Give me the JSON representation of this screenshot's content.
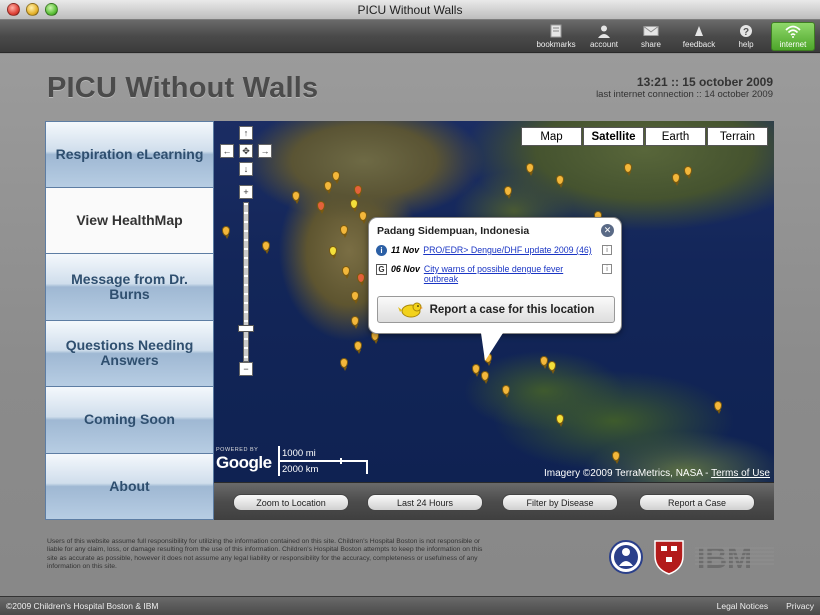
{
  "window": {
    "title": "PICU Without Walls"
  },
  "toolbar": {
    "items": [
      {
        "label": "bookmarks",
        "icon": "bookmarks-icon"
      },
      {
        "label": "account",
        "icon": "account-icon"
      },
      {
        "label": "share",
        "icon": "share-icon"
      },
      {
        "label": "feedback",
        "icon": "feedback-icon"
      },
      {
        "label": "help",
        "icon": "help-icon"
      },
      {
        "label": "internet",
        "icon": "wifi-icon",
        "active": true
      }
    ]
  },
  "header": {
    "title": "PICU Without Walls",
    "clock": "13:21 :: 15 october 2009",
    "last_connection": "last internet connection :: 14 october 2009"
  },
  "sidebar": {
    "items": [
      {
        "label": "Respiration eLearning"
      },
      {
        "label": "View HealthMap",
        "active": true
      },
      {
        "label": "Message from Dr. Burns"
      },
      {
        "label": "Questions Needing Answers"
      },
      {
        "label": "Coming Soon"
      },
      {
        "label": "About"
      }
    ]
  },
  "map": {
    "types": [
      {
        "label": "Map"
      },
      {
        "label": "Satellite",
        "selected": true
      },
      {
        "label": "Earth"
      },
      {
        "label": "Terrain"
      }
    ],
    "scale_mi": "1000 mi",
    "scale_km": "2000 km",
    "powered_by": "POWERED BY",
    "google": "Google",
    "imagery": "Imagery ©2009 TerraMetrics, NASA -",
    "terms": "Terms of Use",
    "popup": {
      "title": "Padang Sidempuan, Indonesia",
      "entries": [
        {
          "date": "11 Nov",
          "text": "PRO/EDR> Dengue/DHF update 2009 (46)"
        },
        {
          "date": "06 Nov",
          "text": "City warns of possible dengue fever outbreak"
        }
      ],
      "report_label": "Report a case for this location"
    }
  },
  "map_toolbar": {
    "buttons": [
      "Zoom to Location",
      "Last 24 Hours",
      "Filter by Disease",
      "Report a Case"
    ]
  },
  "disclaimer": "Users of this website assume full responsibility for utilizing the information contained on this site. Children's Hospital Boston is not responsible or liable for any claim, loss, or damage resulting from the use of this information. Children's Hospital Boston attempts to keep the information on this site as accurate as possible, however it does not assume any legal liability or responsibility for the accuracy, completeness or usefulness of any information on this site.",
  "logos": {
    "ibm": "IBM"
  },
  "footer": {
    "copyright": "©2009 Children's Hospital Boston & IBM",
    "legal": "Legal Notices",
    "privacy": "Privacy"
  },
  "colors": {
    "accent_active": "#5ec23a",
    "sidebar_text": "#2f4f6f",
    "link": "#1a35c4"
  }
}
